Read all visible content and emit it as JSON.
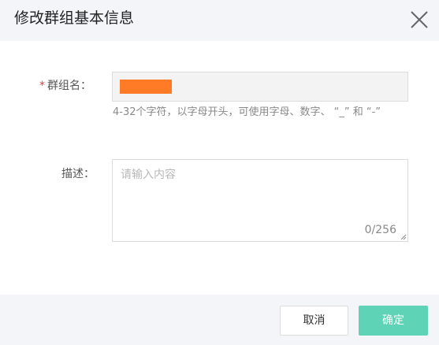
{
  "dialog": {
    "title": "修改群组基本信息",
    "close_icon": "close-icon"
  },
  "form": {
    "name_required_mark": "*",
    "name_label": "群组名：",
    "name_value": "",
    "name_hint": "4-32个字符，以字母开头，可使用字母、数字、 “_” 和 “-”",
    "description_label": "描述：",
    "description_placeholder": "请输入内容",
    "description_counter": "0/256"
  },
  "footer": {
    "cancel_label": "取消",
    "ok_label": "确定"
  },
  "colors": {
    "accent": "#5fd3b6",
    "required": "#e4393c",
    "redaction": "#ff7b26",
    "header_bg": "#f3f5f9"
  }
}
